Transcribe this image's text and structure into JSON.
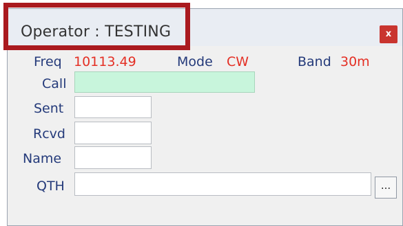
{
  "window": {
    "title": "Operator : TESTING",
    "close_label": "x"
  },
  "info": {
    "freq_label": "Freq",
    "freq_value": "10113.49",
    "mode_label": "Mode",
    "mode_value": "CW",
    "band_label": "Band",
    "band_value": "30m"
  },
  "fields": {
    "call_label": "Call",
    "call_value": "",
    "sent_label": "Sent",
    "sent_value": "",
    "rcvd_label": "Rcvd",
    "rcvd_value": "",
    "name_label": "Name",
    "name_value": "",
    "qth_label": "QTH",
    "qth_value": "",
    "qth_lookup_label": "..."
  },
  "colors": {
    "label": "#243a7a",
    "value": "#e42f24",
    "call_field_bg": "#c8f5dc",
    "highlight_box": "#aa1a1f",
    "close_button": "#c9352f"
  }
}
